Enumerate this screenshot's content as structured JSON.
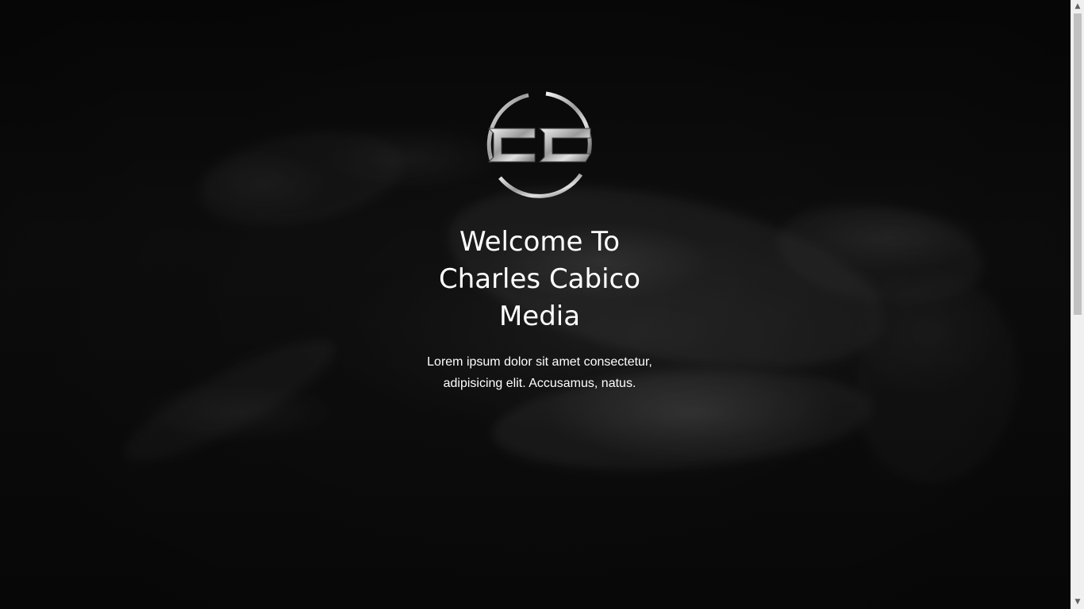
{
  "hero": {
    "logo_icon": "cc-monogram-ring-logo",
    "logo_text": "CC",
    "title": "Welcome To Charles Cabico Media",
    "tagline": "Lorem ipsum dolor sit amet consectetur, adipisicing elit. Accusamus, natus."
  },
  "scrollbar": {
    "up_icon": "chevron-up-icon",
    "down_icon": "chevron-down-icon",
    "up_glyph": "▲",
    "down_glyph": "▼"
  },
  "colors": {
    "background": "#0d0d0d",
    "text": "#ffffff",
    "logo_metal": "#c8c8c8"
  }
}
